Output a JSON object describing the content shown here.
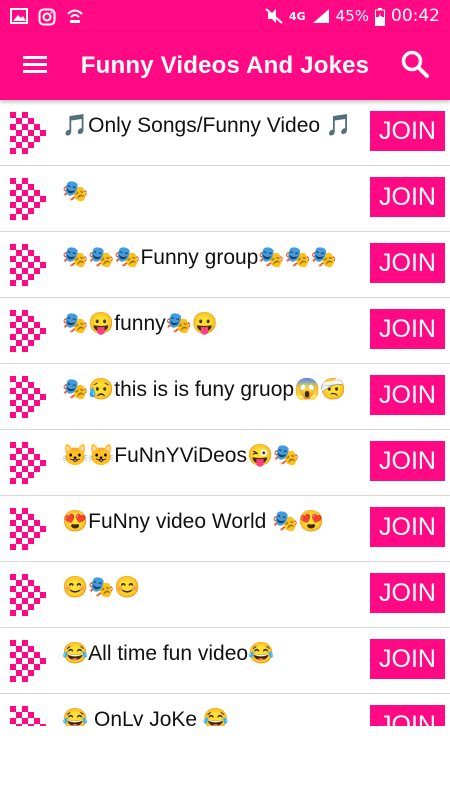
{
  "status_bar": {
    "battery_percent": "45%",
    "network": "4G",
    "time": "00:42"
  },
  "app_bar": {
    "title": "Funny Videos And Jokes",
    "menu_icon": "hamburger-menu-icon",
    "search_icon": "search-icon"
  },
  "colors": {
    "primary": "#ff0a84",
    "text": "#111111"
  },
  "groups": [
    {
      "name": "🎵Only Songs/Funny Video 🎵",
      "join_label": "JOIN"
    },
    {
      "name": "🎭",
      "join_label": "JOIN"
    },
    {
      "name": "🎭🎭🎭Funny group🎭🎭🎭",
      "join_label": "JOIN"
    },
    {
      "name": "🎭😛funny🎭😛",
      "join_label": "JOIN"
    },
    {
      "name": "🎭😥this is is funy gruop😱🤕",
      "join_label": "JOIN"
    },
    {
      "name": "😺😺FuNnYViDeos😜🎭",
      "join_label": "JOIN"
    },
    {
      "name": "😍FuNny video World 🎭😍",
      "join_label": "JOIN"
    },
    {
      "name": "😊🎭😊",
      "join_label": "JOIN"
    },
    {
      "name": "😂All time fun video😂",
      "join_label": "JOIN"
    },
    {
      "name": "😂 OnLy JoKe 😂",
      "join_label": "JOIN"
    }
  ]
}
